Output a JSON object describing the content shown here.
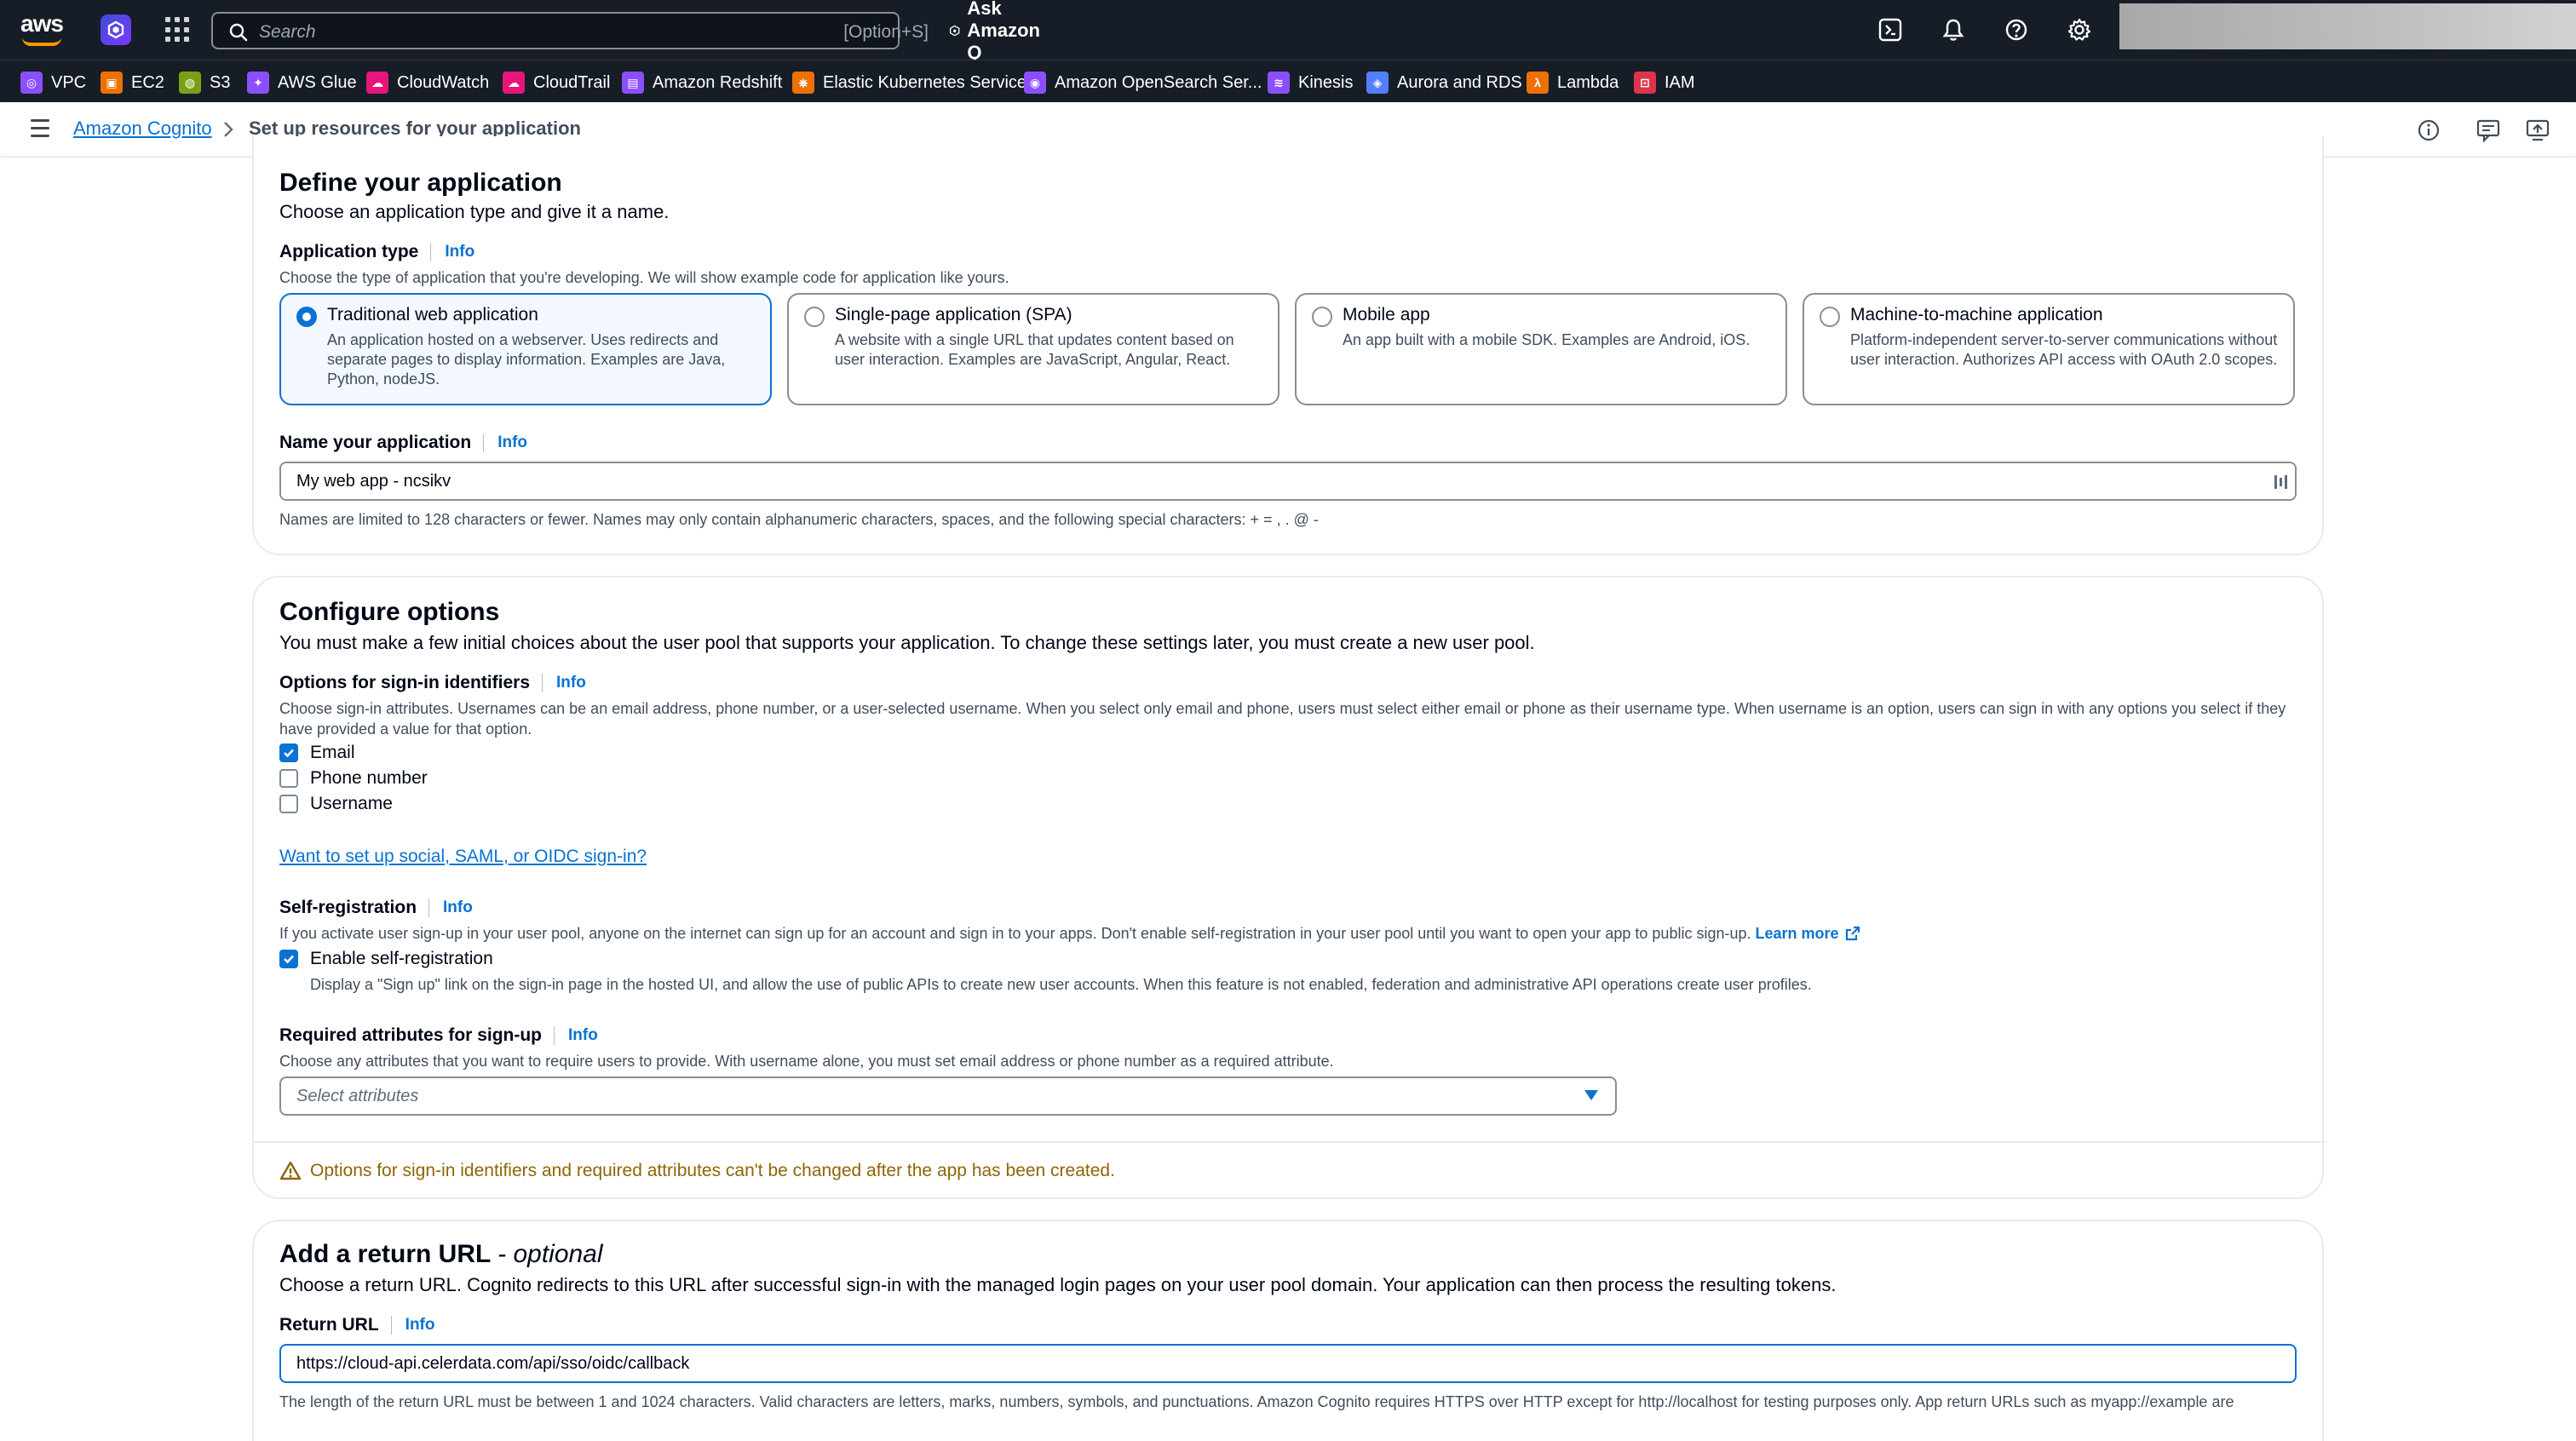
{
  "topnav": {
    "logo_text": "aws",
    "search_placeholder": "Search",
    "search_shortcut": "[Option+S]",
    "ask_label": "Ask Amazon Q"
  },
  "favorites": [
    {
      "label": "VPC",
      "color": "#8c4fff"
    },
    {
      "label": "EC2",
      "color": "#ed7100"
    },
    {
      "label": "S3",
      "color": "#7aa116"
    },
    {
      "label": "AWS Glue",
      "color": "#8c4fff"
    },
    {
      "label": "CloudWatch",
      "color": "#e7157b"
    },
    {
      "label": "CloudTrail",
      "color": "#e7157b"
    },
    {
      "label": "Amazon Redshift",
      "color": "#8c4fff"
    },
    {
      "label": "Elastic Kubernetes Service",
      "color": "#ed7100"
    },
    {
      "label": "Amazon OpenSearch Ser...",
      "color": "#8c4fff"
    },
    {
      "label": "Kinesis",
      "color": "#8c4fff"
    },
    {
      "label": "Aurora and RDS",
      "color": "#527fff"
    },
    {
      "label": "Lambda",
      "color": "#ed7100"
    },
    {
      "label": "IAM",
      "color": "#dd344c"
    }
  ],
  "breadcrumb": {
    "root": "Amazon Cognito",
    "current": "Set up resources for your application"
  },
  "define": {
    "title": "Define your application",
    "description": "Choose an application type and give it a name.",
    "app_type_label": "Application type",
    "info": "Info",
    "app_type_desc": "Choose the type of application that you're developing. We will show example code for application like yours.",
    "tiles": [
      {
        "title": "Traditional web application",
        "desc": "An application hosted on a webserver. Uses redirects and separate pages to display information. Examples are Java, Python, nodeJS.",
        "selected": true
      },
      {
        "title": "Single-page application (SPA)",
        "desc": "A website with a single URL that updates content based on user interaction. Examples are JavaScript, Angular, React.",
        "selected": false
      },
      {
        "title": "Mobile app",
        "desc": "An app built with a mobile SDK. Examples are Android, iOS.",
        "selected": false
      },
      {
        "title": "Machine-to-machine application",
        "desc": "Platform-independent server-to-server communications without user interaction. Authorizes API access with OAuth 2.0 scopes.",
        "selected": false
      }
    ],
    "name_label": "Name your application",
    "name_value": "My web app - ncsikv",
    "name_constraint": "Names are limited to 128 characters or fewer. Names may only contain alphanumeric characters, spaces, and the following special characters: + = , . @ -"
  },
  "configure": {
    "title": "Configure options",
    "description": "You must make a few initial choices about the user pool that supports your application. To change these settings later, you must create a new user pool.",
    "signin_label": "Options for sign-in identifiers",
    "signin_desc": "Choose sign-in attributes. Usernames can be an email address, phone number, or a user-selected username. When you select only email and phone, users must select either email or phone as their username type. When username is an option, users can sign in with any options you select if they have provided a value for that option.",
    "identifiers": [
      {
        "label": "Email",
        "checked": true
      },
      {
        "label": "Phone number",
        "checked": false
      },
      {
        "label": "Username",
        "checked": false
      }
    ],
    "social_link": "Want to set up social, SAML, or OIDC sign-in?",
    "selfreg_label": "Self-registration",
    "selfreg_desc": "If you activate user sign-up in your user pool, anyone on the internet can sign up for an account and sign in to your apps. Don't enable self-registration in your user pool until you want to open your app to public sign-up.",
    "learn_more": "Learn more",
    "selfreg_checkbox": "Enable self-registration",
    "selfreg_checkbox_desc": "Display a \"Sign up\" link on the sign-in page in the hosted UI, and allow the use of public APIs to create new user accounts. When this feature is not enabled, federation and administrative API operations create user profiles.",
    "required_label": "Required attributes for sign-up",
    "required_desc": "Choose any attributes that you want to require users to provide. With username alone, you must set email address or phone number as a required attribute.",
    "required_placeholder": "Select attributes",
    "warning": "Options for sign-in identifiers and required attributes can't be changed after the app has been created."
  },
  "return_url": {
    "title": "Add a return URL",
    "optional": "- optional",
    "description": "Choose a return URL. Cognito redirects to this URL after successful sign-in with the managed login pages on your user pool domain. Your application can then process the resulting tokens.",
    "label": "Return URL",
    "value": "https://cloud-api.celerdata.com/api/sso/oidc/callback",
    "constraint": "The length of the return URL must be between 1 and 1024 characters. Valid characters are letters, marks, numbers, symbols, and punctuations. Amazon Cognito requires HTTPS over HTTP except for http://localhost for testing purposes only. App return URLs such as myapp://example are"
  }
}
